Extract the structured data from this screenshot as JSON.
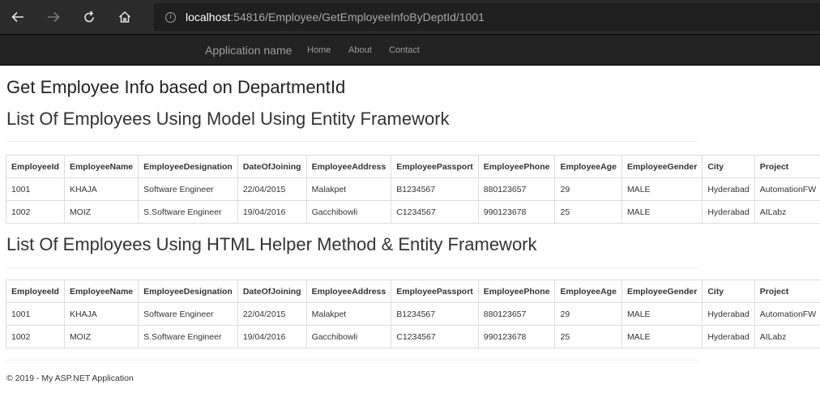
{
  "browser": {
    "url_host": "localhost",
    "url_rest": ":54816/Employee/GetEmployeeInfoByDeptId/1001",
    "icons": [
      "back-arrow-icon",
      "forward-arrow-icon",
      "refresh-icon",
      "home-icon",
      "info-icon"
    ]
  },
  "navbar": {
    "brand": "Application name",
    "links": [
      "Home",
      "About",
      "Contact"
    ]
  },
  "page": {
    "title": "Get Employee Info based on DepartmentId",
    "section1_title": "List Of Employees Using Model Using Entity Framework",
    "section2_title": "List Of Employees Using HTML Helper Method & Entity Framework"
  },
  "table": {
    "columns": [
      "EmployeeId",
      "EmployeeName",
      "EmployeeDesignation",
      "DateOfJoining",
      "EmployeeAddress",
      "EmployeePassport",
      "EmployeePhone",
      "EmployeeAge",
      "EmployeeGender",
      "City",
      "Project"
    ],
    "rows": [
      [
        "1001",
        "KHAJA",
        "Software Engineer",
        "22/04/2015",
        "Malakpet",
        "B1234567",
        "880123657",
        "29",
        "MALE",
        "Hyderabad",
        "AutomationFW"
      ],
      [
        "1002",
        "MOIZ",
        "S.Software Engineer",
        "19/04/2016",
        "Gacchibowli",
        "C1234567",
        "990123678",
        "25",
        "MALE",
        "Hyderabad",
        "AILabz"
      ]
    ]
  },
  "footer": {
    "text": "© 2019 - My ASP.NET Application"
  }
}
